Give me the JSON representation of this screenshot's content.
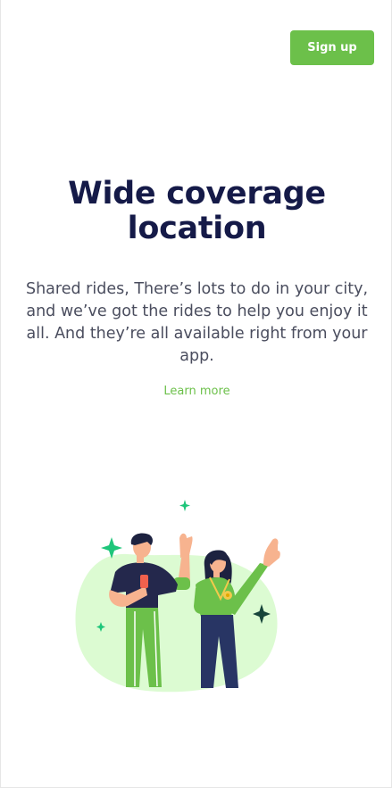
{
  "header": {
    "signup_label": "Sign up"
  },
  "hero": {
    "title_line1": "Wide coverage",
    "title_line2": "location",
    "description": "Shared rides, There’s lots to do in your city, and we’ve got the rides to help you enjoy it all. And they’re all available right from your app.",
    "learn_more_label": "Learn more"
  },
  "colors": {
    "accent": "#6cc04a",
    "title": "#151a48",
    "body_text": "#4a4d5e",
    "blob": "#dcfbd2"
  },
  "illustration": {
    "name": "friends-waving-illustration",
    "icons": [
      "sparkle-icon"
    ]
  }
}
